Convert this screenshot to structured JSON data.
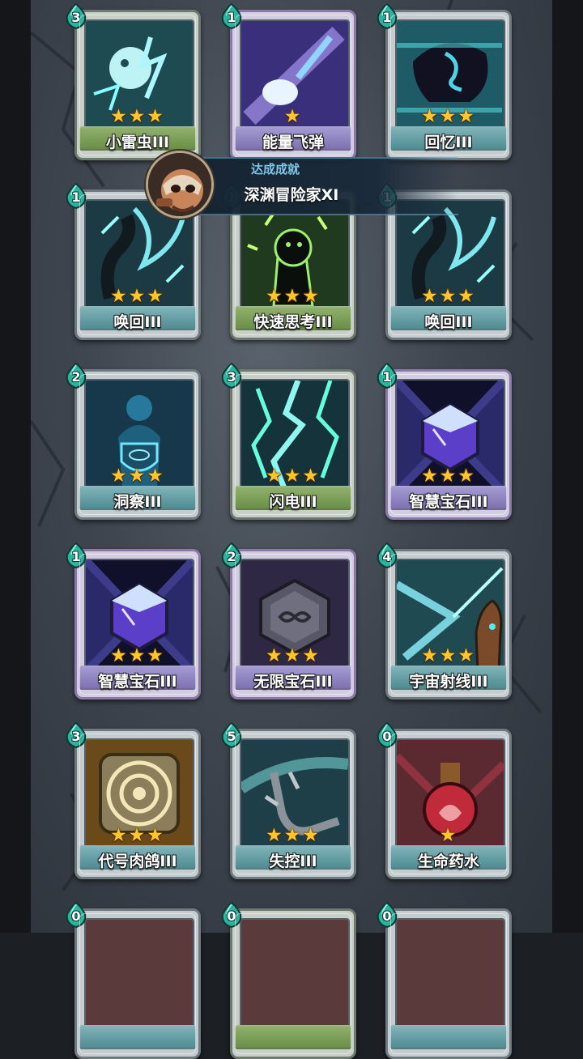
{
  "achievement": {
    "title": "达成成就",
    "name": "深渊冒险家XI",
    "avatar_icon": "masked-adventurer-portrait"
  },
  "cards": [
    {
      "name": "小雷虫III",
      "cost": "3",
      "stars": "★★★",
      "art": "lightning-creature-icon",
      "frame": "green"
    },
    {
      "name": "能量飞弹",
      "cost": "1",
      "stars": "★",
      "art": "energy-missile-icon",
      "frame": "purple"
    },
    {
      "name": "回忆III",
      "cost": "1",
      "stars": "★★★",
      "art": "memory-head-icon",
      "frame": "teal"
    },
    {
      "name": "唤回III",
      "cost": "1",
      "stars": "★★★",
      "art": "recall-claw-icon",
      "frame": "teal"
    },
    {
      "name": "快速思考III",
      "cost": "1",
      "stars": "★★★",
      "art": "quick-think-figure-icon",
      "frame": "green"
    },
    {
      "name": "唤回III",
      "cost": "1",
      "stars": "★★★",
      "art": "recall-claw-icon",
      "frame": "teal"
    },
    {
      "name": "洞察III",
      "cost": "2",
      "stars": "★★★",
      "art": "insight-shield-figure-icon",
      "frame": "teal"
    },
    {
      "name": "闪电III",
      "cost": "3",
      "stars": "★★★",
      "art": "lightning-bolt-icon",
      "frame": "green"
    },
    {
      "name": "智慧宝石III",
      "cost": "1",
      "stars": "★★★",
      "art": "wisdom-gem-icon",
      "frame": "purple"
    },
    {
      "name": "智慧宝石III",
      "cost": "1",
      "stars": "★★★",
      "art": "wisdom-gem-icon",
      "frame": "purple"
    },
    {
      "name": "无限宝石III",
      "cost": "2",
      "stars": "★★★",
      "art": "infinity-gem-icon",
      "frame": "purple"
    },
    {
      "name": "宇宙射线III",
      "cost": "4",
      "stars": "★★★",
      "art": "cosmic-ray-hand-icon",
      "frame": "teal"
    },
    {
      "name": "代号肉鸽III",
      "cost": "3",
      "stars": "★★★",
      "art": "roguelike-disc-icon",
      "frame": "teal"
    },
    {
      "name": "失控III",
      "cost": "5",
      "stars": "★★★",
      "art": "runaway-skeleton-arm-icon",
      "frame": "teal"
    },
    {
      "name": "生命药水",
      "cost": "0",
      "stars": "★",
      "art": "life-potion-icon",
      "frame": "teal"
    },
    {
      "name": "",
      "cost": "0",
      "stars": "",
      "art": "card-partial-icon",
      "frame": "teal"
    },
    {
      "name": "",
      "cost": "0",
      "stars": "",
      "art": "card-partial-icon",
      "frame": "green"
    },
    {
      "name": "",
      "cost": "0",
      "stars": "",
      "art": "card-partial-icon",
      "frame": "teal"
    }
  ],
  "colors": {
    "star": "#ffc72b",
    "cost_badge": "#2fb3a0",
    "toast_title": "#7fc6e8"
  }
}
